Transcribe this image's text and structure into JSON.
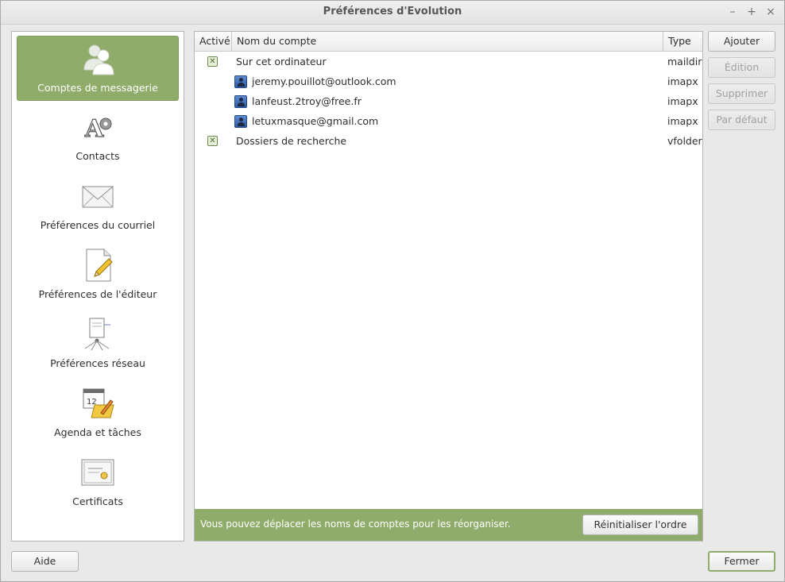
{
  "window": {
    "title": "Préférences d'Evolution",
    "controls": {
      "minimize": "–",
      "maximize": "+",
      "close": "×"
    }
  },
  "sidebar": {
    "items": [
      {
        "label": "Comptes de messagerie",
        "icon": "people-icon",
        "active": true
      },
      {
        "label": "Contacts",
        "icon": "contacts-gear-icon",
        "active": false
      },
      {
        "label": "Préférences du courriel",
        "icon": "envelope-icon",
        "active": false
      },
      {
        "label": "Préférences de l'éditeur",
        "icon": "document-pencil-icon",
        "active": false
      },
      {
        "label": "Préférences réseau",
        "icon": "network-icon",
        "active": false
      },
      {
        "label": "Agenda et tâches",
        "icon": "calendar-icon",
        "active": false
      },
      {
        "label": "Certificats",
        "icon": "certificate-icon",
        "active": false
      }
    ]
  },
  "accounts": {
    "columns": {
      "enabled": "Activé",
      "name": "Nom du compte",
      "type": "Type"
    },
    "rows": [
      {
        "enabled": true,
        "name": "Sur cet ordinateur",
        "type": "maildir",
        "is_account": false
      },
      {
        "enabled": null,
        "name": "jeremy.pouillot@outlook.com",
        "type": "imapx",
        "is_account": true
      },
      {
        "enabled": null,
        "name": "lanfeust.2troy@free.fr",
        "type": "imapx",
        "is_account": true
      },
      {
        "enabled": null,
        "name": "letuxmasque@gmail.com",
        "type": "imapx",
        "is_account": true
      },
      {
        "enabled": true,
        "name": "Dossiers de recherche",
        "type": "vfolder",
        "is_account": false
      }
    ],
    "info_message": "Vous pouvez déplacer les noms de comptes pour les réorganiser.",
    "reset_order_label": "Réinitialiser l'ordre"
  },
  "actions": {
    "add": "Ajouter",
    "edit": "Édition",
    "delete": "Supprimer",
    "default": "Par défaut"
  },
  "footer": {
    "help": "Aide",
    "close": "Fermer"
  },
  "colors": {
    "accent": "#8fac6b",
    "background": "#e9e9e9"
  }
}
